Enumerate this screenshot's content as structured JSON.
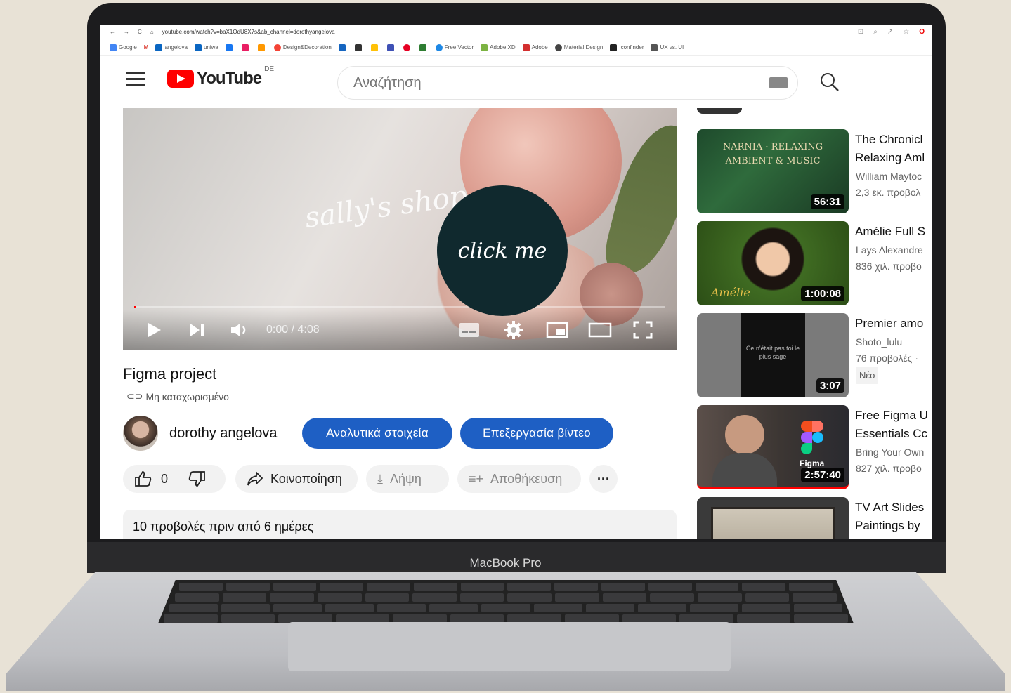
{
  "device": {
    "label": "MacBook Pro"
  },
  "browser": {
    "url": "youtube.com/watch?v=baX1OdU8X7s&ab_channel=dorothyangelova",
    "bookmarks": [
      "Google",
      "angelova",
      "uniwa",
      "Design&Decoration",
      "Free Vector",
      "Adobe XD",
      "Adobe",
      "Material Design",
      "Iconfinder",
      "UX vs. UI"
    ]
  },
  "header": {
    "logo_text": "YouTube",
    "region": "DE",
    "search_placeholder": "Αναζήτηση"
  },
  "player": {
    "watermark": "sally's shop",
    "overlay_button": "click me",
    "time": "0:00 / 4:08",
    "progress_fraction": 0.0
  },
  "video": {
    "title": "Figma project",
    "visibility": "Μη καταχωρισμένο",
    "channel": "dorothy angelova",
    "details_button": "Αναλυτικά στοιχεία",
    "edit_button": "Επεξεργασία βίντεο",
    "likes": "0",
    "share_label": "Κοινοποίηση",
    "download_label": "Λήψη",
    "save_label": "Αποθήκευση",
    "more_label": "···",
    "stats": "10 προβολές  πριν από 6 ημέρες"
  },
  "recommendations": [
    {
      "title1": "The Chronicl",
      "title2": "Relaxing Aml",
      "channel": "William Maytoc",
      "views": "2,3 εκ. προβολ",
      "duration": "56:31",
      "thumb_text": "NARNIA · RELAXING AMBIENT & MUSIC"
    },
    {
      "title1": "Amélie Full S",
      "channel": "Lays Alexandre",
      "views": "836 χιλ. προβο",
      "duration": "1:00:08",
      "thumb_text": "Amélie"
    },
    {
      "title1": "Premier amo",
      "channel": "Shoto_lulu",
      "views": "76 προβολές ·",
      "badge": "Νέο",
      "duration": "3:07",
      "thumb_text": "Ce n'était pas toi le plus sage"
    },
    {
      "title1": "Free Figma U",
      "title2": "Essentials Cc",
      "channel": "Bring Your Own",
      "views": "827 χιλ. προβο",
      "duration": "2:57:40",
      "thumb_text": "Figma"
    },
    {
      "title1": "TV Art Slides",
      "title2": "Paintings by"
    }
  ],
  "colors": {
    "accent_blue": "#1e5fc4",
    "youtube_red": "#ff0000",
    "overlay_button": "#10292e"
  }
}
